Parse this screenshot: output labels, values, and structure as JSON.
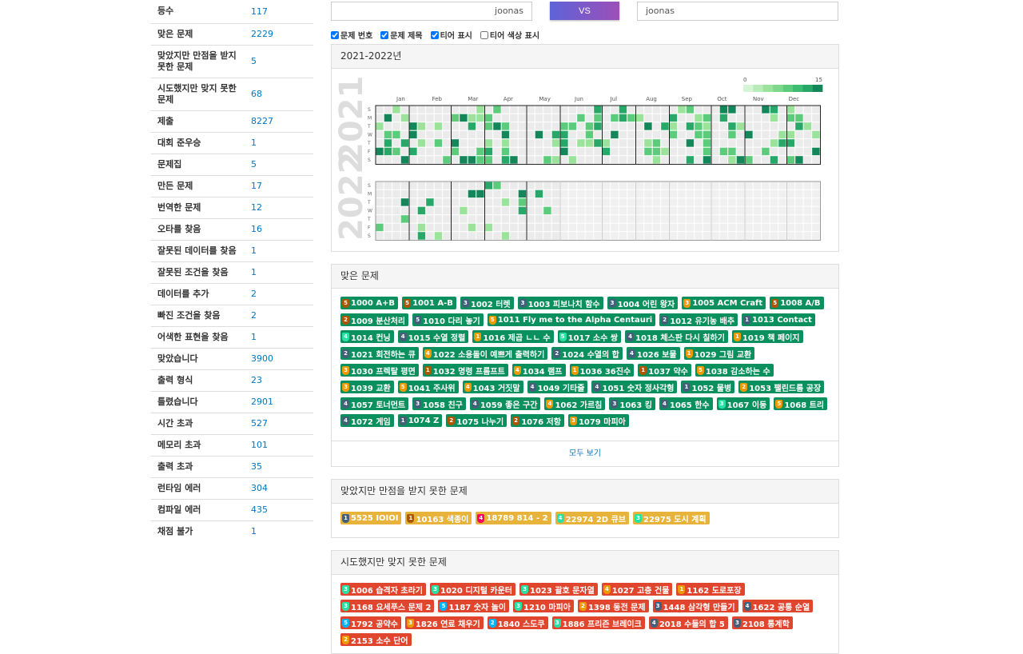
{
  "stats": [
    {
      "label": "등수",
      "value": "117"
    },
    {
      "label": "맞은 문제",
      "value": "2229"
    },
    {
      "label": "맞았지만 만점을 받지 못한 문제",
      "value": "5"
    },
    {
      "label": "시도했지만 맞지 못한 문제",
      "value": "68"
    },
    {
      "label": "제출",
      "value": "8227"
    },
    {
      "label": "대회 준우승",
      "value": "1"
    },
    {
      "label": "문제집",
      "value": "5"
    },
    {
      "label": "만든 문제",
      "value": "17"
    },
    {
      "label": "번역한 문제",
      "value": "12"
    },
    {
      "label": "오타를 찾음",
      "value": "16"
    },
    {
      "label": "잘못된 데이터를 찾음",
      "value": "1"
    },
    {
      "label": "잘못된 조건을 찾음",
      "value": "1"
    },
    {
      "label": "데이터를 추가",
      "value": "2"
    },
    {
      "label": "빠진 조건을 찾음",
      "value": "2"
    },
    {
      "label": "어색한 표현을 찾음",
      "value": "1"
    },
    {
      "label": "맞았습니다",
      "value": "3900"
    },
    {
      "label": "출력 형식",
      "value": "23"
    },
    {
      "label": "틀렸습니다",
      "value": "2901"
    },
    {
      "label": "시간 초과",
      "value": "527"
    },
    {
      "label": "메모리 초과",
      "value": "101"
    },
    {
      "label": "출력 초과",
      "value": "35"
    },
    {
      "label": "런타임 에러",
      "value": "304"
    },
    {
      "label": "컴파일 에러",
      "value": "435"
    },
    {
      "label": "채점 불가",
      "value": "1"
    }
  ],
  "vs": {
    "left": "joonas",
    "button": "VS",
    "right": "joonas"
  },
  "options": [
    {
      "label": "문제 번호",
      "checked": true
    },
    {
      "label": "문제 제목",
      "checked": true
    },
    {
      "label": "티어 표시",
      "checked": true
    },
    {
      "label": "티어 색상 표시",
      "checked": false
    }
  ],
  "heatmap": {
    "title": "2021-2022년",
    "years": [
      "2021",
      "2022"
    ],
    "months": [
      "Jan",
      "Feb",
      "Mar",
      "Apr",
      "May",
      "Jun",
      "Jul",
      "Aug",
      "Sep",
      "Oct",
      "Nov",
      "Dec"
    ],
    "weekdays": [
      "S",
      "M",
      "T",
      "W",
      "T",
      "F",
      "S"
    ],
    "legend_min": "0",
    "legend_max": "15",
    "colors": {
      "empty": "#ebebeb",
      "l1": "#9be29b",
      "l2": "#5ccc7c",
      "l3": "#27a868",
      "l4": "#14875a",
      "border": "#222"
    }
  },
  "solved": {
    "title": "맞은 문제",
    "more": "모두 보기",
    "items": [
      {
        "t": "b",
        "n": "5",
        "text": "1000 A+B"
      },
      {
        "t": "b",
        "n": "5",
        "text": "1001 A-B"
      },
      {
        "t": "s",
        "n": "3",
        "text": "1002 터렛"
      },
      {
        "t": "s",
        "n": "3",
        "text": "1003 피보나치 함수"
      },
      {
        "t": "s",
        "n": "3",
        "text": "1004 어린 왕자"
      },
      {
        "t": "g",
        "n": "3",
        "text": "1005 ACM Craft"
      },
      {
        "t": "b",
        "n": "5",
        "text": "1008 A/B"
      },
      {
        "t": "b",
        "n": "2",
        "text": "1009 분산처리"
      },
      {
        "t": "s",
        "n": "5",
        "text": "1010 다리 놓기"
      },
      {
        "t": "g",
        "n": "5",
        "text": "1011 Fly me to the Alpha Centauri"
      },
      {
        "t": "s",
        "n": "2",
        "text": "1012 유기농 배추"
      },
      {
        "t": "s",
        "n": "1",
        "text": "1013 Contact"
      },
      {
        "t": "p",
        "n": "4",
        "text": "1014 컨닝"
      },
      {
        "t": "s",
        "n": "4",
        "text": "1015 수열 정렬"
      },
      {
        "t": "g",
        "n": "1",
        "text": "1016 제곱 ㄴㄴ 수"
      },
      {
        "t": "p",
        "n": "5",
        "text": "1017 소수 쌍"
      },
      {
        "t": "s",
        "n": "4",
        "text": "1018 체스판 다시 칠하기"
      },
      {
        "t": "g",
        "n": "1",
        "text": "1019 책 페이지"
      },
      {
        "t": "s",
        "n": "2",
        "text": "1021 회전하는 큐"
      },
      {
        "t": "g",
        "n": "4",
        "text": "1022 소용돌이 예쁘게 출력하기"
      },
      {
        "t": "s",
        "n": "2",
        "text": "1024 수열의 합"
      },
      {
        "t": "s",
        "n": "4",
        "text": "1026 보물"
      },
      {
        "t": "g",
        "n": "1",
        "text": "1029 그림 교환"
      },
      {
        "t": "g",
        "n": "3",
        "text": "1030 프렉탈 평면"
      },
      {
        "t": "b",
        "n": "1",
        "text": "1032 명령 프롬프트"
      },
      {
        "t": "g",
        "n": "4",
        "text": "1034 램프"
      },
      {
        "t": "g",
        "n": "1",
        "text": "1036 36진수"
      },
      {
        "t": "b",
        "n": "1",
        "text": "1037 약수"
      },
      {
        "t": "g",
        "n": "5",
        "text": "1038 감소하는 수"
      },
      {
        "t": "g",
        "n": "3",
        "text": "1039 교환"
      },
      {
        "t": "g",
        "n": "5",
        "text": "1041 주사위"
      },
      {
        "t": "g",
        "n": "4",
        "text": "1043 거짓말"
      },
      {
        "t": "s",
        "n": "4",
        "text": "1049 기타줄"
      },
      {
        "t": "s",
        "n": "4",
        "text": "1051 숫자 정사각형"
      },
      {
        "t": "s",
        "n": "1",
        "text": "1052 물병"
      },
      {
        "t": "g",
        "n": "2",
        "text": "1053 팰린드롬 공장"
      },
      {
        "t": "s",
        "n": "4",
        "text": "1057 토너먼트"
      },
      {
        "t": "s",
        "n": "3",
        "text": "1058 친구"
      },
      {
        "t": "s",
        "n": "4",
        "text": "1059 좋은 구간"
      },
      {
        "t": "g",
        "n": "4",
        "text": "1062 가르침"
      },
      {
        "t": "s",
        "n": "3",
        "text": "1063 킹"
      },
      {
        "t": "s",
        "n": "4",
        "text": "1065 한수"
      },
      {
        "t": "p",
        "n": "3",
        "text": "1067 이동"
      },
      {
        "t": "g",
        "n": "5",
        "text": "1068 트리"
      },
      {
        "t": "s",
        "n": "4",
        "text": "1072 게임"
      },
      {
        "t": "s",
        "n": "1",
        "text": "1074 Z"
      },
      {
        "t": "b",
        "n": "2",
        "text": "1075 나누기"
      },
      {
        "t": "b",
        "n": "2",
        "text": "1076 저항"
      },
      {
        "t": "g",
        "n": "3",
        "text": "1079 마피아"
      }
    ]
  },
  "partial": {
    "title": "맞았지만 만점을 받지 못한 문제",
    "items": [
      {
        "t": "s",
        "n": "1",
        "text": "5525 IOIOI"
      },
      {
        "t": "b",
        "n": "1",
        "text": "10163 색종이"
      },
      {
        "t": "r",
        "n": "4",
        "text": "18789 814 - 2"
      },
      {
        "t": "p",
        "n": "4",
        "text": "22974 2D 큐브"
      },
      {
        "t": "p",
        "n": "3",
        "text": "22975 도시 계획"
      }
    ]
  },
  "failed": {
    "title": "시도했지만 맞지 못한 문제",
    "items": [
      {
        "t": "p",
        "n": "3",
        "text": "1006 습격자 초라기"
      },
      {
        "t": "p",
        "n": "3",
        "text": "1020 디지털 카운터"
      },
      {
        "t": "p",
        "n": "3",
        "text": "1023 괄호 문자열"
      },
      {
        "t": "g",
        "n": "4",
        "text": "1027 고층 건물"
      },
      {
        "t": "g",
        "n": "1",
        "text": "1162 도로포장"
      },
      {
        "t": "p",
        "n": "3",
        "text": "1168 요세푸스 문제 2"
      },
      {
        "t": "d",
        "n": "5",
        "text": "1187 숫자 놀이"
      },
      {
        "t": "p",
        "n": "3",
        "text": "1210 마피아"
      },
      {
        "t": "g",
        "n": "2",
        "text": "1398 동전 문제"
      },
      {
        "t": "s",
        "n": "3",
        "text": "1448 삼각형 만들기"
      },
      {
        "t": "s",
        "n": "4",
        "text": "1622 공통 순열"
      },
      {
        "t": "d",
        "n": "5",
        "text": "1792 공약수"
      },
      {
        "t": "g",
        "n": "3",
        "text": "1826 연료 채우기"
      },
      {
        "t": "d",
        "n": "2",
        "text": "1840 스도쿠"
      },
      {
        "t": "p",
        "n": "3",
        "text": "1886 프리즌 브레이크"
      },
      {
        "t": "s",
        "n": "4",
        "text": "2018 수들의 합 5"
      },
      {
        "t": "s",
        "n": "3",
        "text": "2108 통계학"
      },
      {
        "t": "g",
        "n": "2",
        "text": "2153 소수 단어"
      }
    ]
  }
}
